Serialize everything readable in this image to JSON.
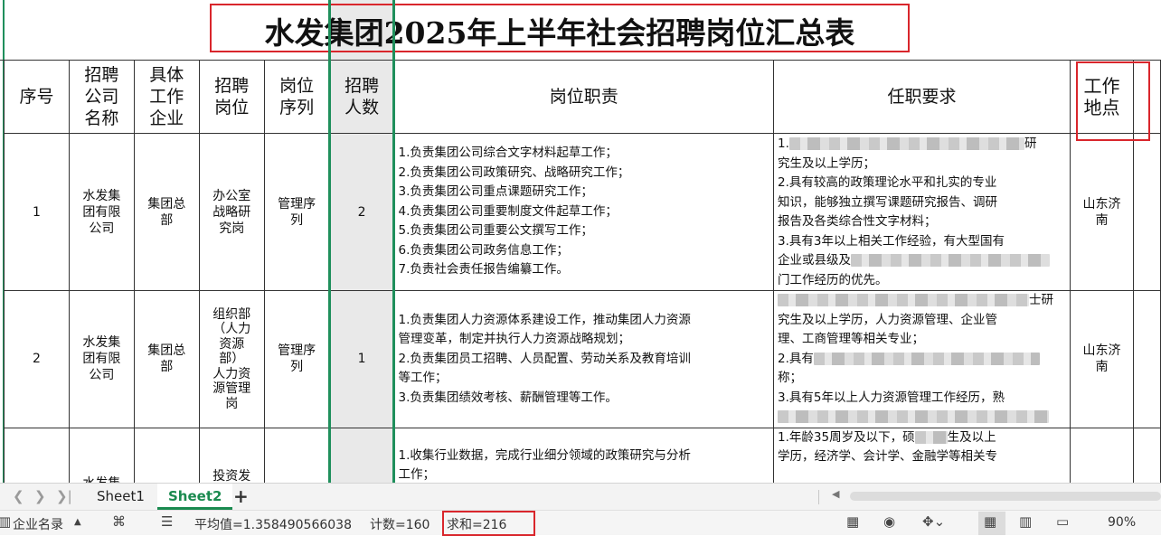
{
  "sheet": {
    "title": "水发集团2025年上半年社会招聘岗位汇总表",
    "headers": [
      "序号",
      "招聘公司名称",
      "具体工作企业",
      "招聘岗位",
      "岗位序列",
      "招聘人数",
      "岗位职责",
      "任职要求",
      "工作地点"
    ],
    "header_lines": {
      "company": [
        "招聘",
        "公司",
        "名称"
      ],
      "work_company": [
        "具体",
        "工作",
        "企业"
      ],
      "position": [
        "招聘",
        "岗位"
      ],
      "sequence": [
        "岗位",
        "序列"
      ],
      "count": [
        "招聘",
        "人数"
      ],
      "location": [
        "工作",
        "地点"
      ]
    },
    "rows": [
      {
        "no": "1",
        "company": [
          "水发集",
          "团有限",
          "公司"
        ],
        "work_company": [
          "集团总",
          "部"
        ],
        "position": [
          "办公室",
          "战略研",
          "究岗"
        ],
        "sequence": [
          "管理序",
          "列"
        ],
        "count": "2",
        "duties": [
          "1.负责集团公司综合文字材料起草工作；",
          "2.负责集团公司政策研究、战略研究工作；",
          "3.负责集团公司重点课题研究工作；",
          "4.负责集团公司重要制度文件起草工作；",
          "5.负责集团公司重要公文撰写工作；",
          "6.负责集团公司政务信息工作；",
          "7.负责社会责任报告编纂工作。"
        ],
        "requirements": {
          "line1_start": "1.",
          "line1_end": "研",
          "line2": "究生及以上学历；",
          "line3": "2.具有较高的政策理论水平和扎实的专业",
          "line4": "知识，能够独立撰写课题研究报告、调研",
          "line5": "报告及各类综合性文字材料；",
          "line6": "3.具有3年以上相关工作经验，有大型国有",
          "line7_start": "企业或县级及",
          "line8": "门工作经历的优先。"
        },
        "location": [
          "山东济",
          "南"
        ]
      },
      {
        "no": "2",
        "company": [
          "水发集",
          "团有限",
          "公司"
        ],
        "work_company": [
          "集团总",
          "部"
        ],
        "position": [
          "组织部",
          "（人力",
          "资源",
          "部）",
          "人力资",
          "源管理",
          "岗"
        ],
        "sequence": [
          "管理序",
          "列"
        ],
        "count": "1",
        "duties": [
          "1.负责集团人力资源体系建设工作，推动集团人力资源",
          "管理变革，制定并执行人力资源战略规划；",
          "2.负责集团员工招聘、人员配置、劳动关系及教育培训",
          "等工作；",
          "3.负责集团绩效考核、薪酬管理等工作。"
        ],
        "requirements": {
          "line1_end": "士研",
          "line2": "究生及以上学历，人力资源管理、企业管",
          "line3": "理、工商管理等相关专业；",
          "line4_start": "2.具有",
          "line5": "称；",
          "line6": "3.具有5年以上人力资源管理工作经历，熟"
        },
        "location": [
          "山东济",
          "南"
        ]
      },
      {
        "no": "",
        "company": [
          "水发集"
        ],
        "position": [
          "投资发"
        ],
        "duties": [
          "1.收集行业数据，完成行业细分领域的政策研究与分析",
          "工作；"
        ],
        "requirements": {
          "line1_start": "1.年龄35周岁及以下，硕",
          "line1_end": "生及以上",
          "line2": "学历，经济学、会计学、金融学等相关专"
        }
      }
    ]
  },
  "tabs": {
    "items": [
      "Sheet1",
      "Sheet2"
    ],
    "active": "Sheet2",
    "add_label": "+"
  },
  "status": {
    "directory_label": "企业名录",
    "average": "平均值=1.358490566038",
    "count": "计数=160",
    "sum": "求和=216",
    "zoom": "90%"
  },
  "accent_colors": {
    "highlight_red": "#d9262c",
    "selection_green": "#1f8f5c",
    "active_tab_green": "#1a8a4f"
  },
  "icons": [
    "nav-prev-icon",
    "nav-next-icon",
    "nav-last-icon",
    "add-sheet-icon",
    "directory-icon",
    "dropdown-icon",
    "macro-icon",
    "protect-icon",
    "layout-icon",
    "eye-icon",
    "freeze-icon",
    "normal-view-icon",
    "page-break-view-icon",
    "page-layout-view-icon"
  ]
}
